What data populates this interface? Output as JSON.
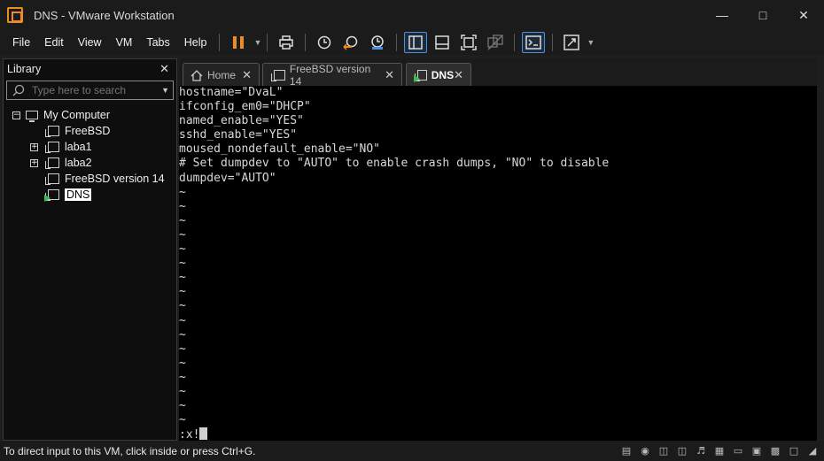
{
  "window": {
    "title": "DNS - VMware Workstation"
  },
  "menu": [
    "File",
    "Edit",
    "View",
    "VM",
    "Tabs",
    "Help"
  ],
  "toolbar": {
    "icons": [
      "pause-icon",
      "print-icon",
      "snapshot-icon",
      "revert-icon",
      "snapshot-manager-icon",
      "library-view-icon",
      "thumbnail-view-icon",
      "fullscreen-icon",
      "unity-icon",
      "console-icon",
      "stretch-icon"
    ]
  },
  "library": {
    "title": "Library",
    "search_placeholder": "Type here to search",
    "tree": [
      {
        "label": "My Computer"
      },
      {
        "label": "FreeBSD"
      },
      {
        "label": "laba1"
      },
      {
        "label": "laba2"
      },
      {
        "label": "FreeBSD version 14"
      },
      {
        "label": "DNS"
      }
    ]
  },
  "tabs": [
    {
      "label": "Home"
    },
    {
      "label": "FreeBSD version 14"
    },
    {
      "label": "DNS"
    }
  ],
  "console": {
    "lines": [
      "hostname=\"DvaL\"",
      "ifconfig_em0=\"DHCP\"",
      "named_enable=\"YES\"",
      "sshd_enable=\"YES\"",
      "moused_nondefault_enable=\"NO\"",
      "# Set dumpdev to \"AUTO\" to enable crash dumps, \"NO\" to disable",
      "dumpdev=\"AUTO\"",
      "~",
      "~",
      "~",
      "~",
      "~",
      "~",
      "~",
      "~",
      "~",
      "~",
      "~",
      "~",
      "~",
      "~",
      "~",
      "~",
      "~"
    ],
    "command": ":x!"
  },
  "status": {
    "text": "To direct input to this VM, click inside or press Ctrl+G."
  }
}
